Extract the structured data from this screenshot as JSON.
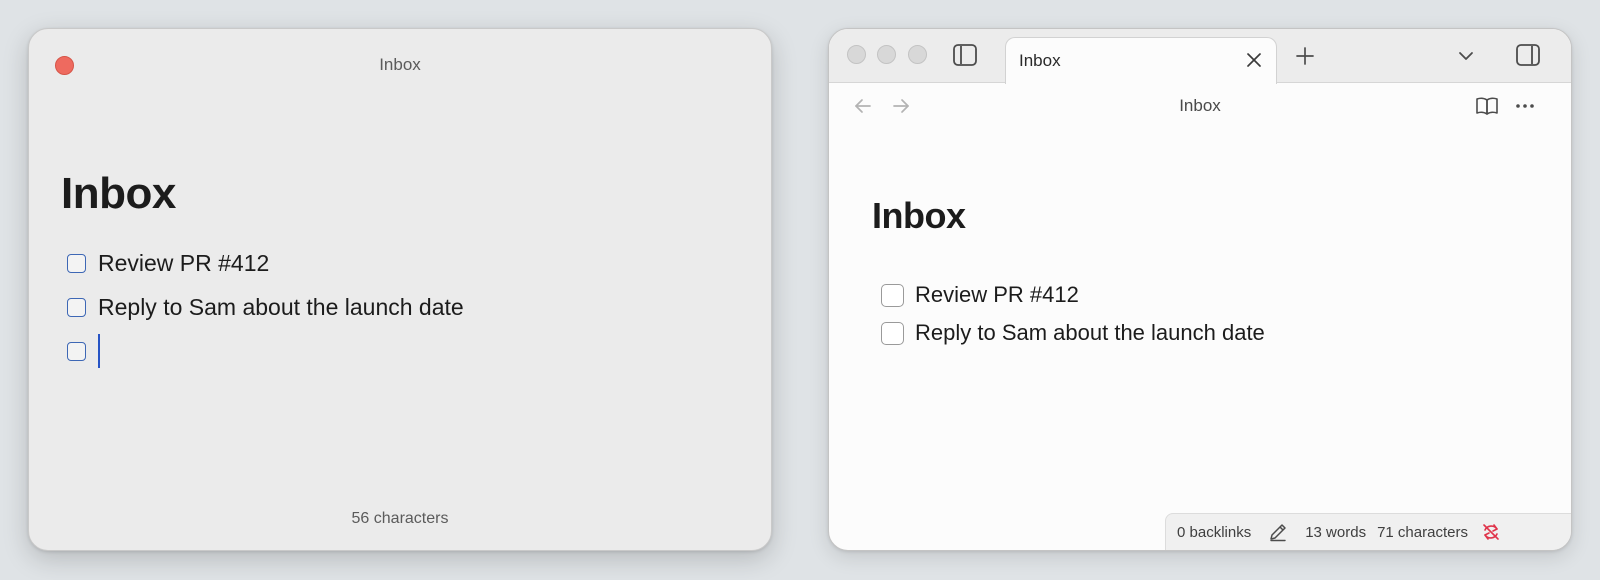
{
  "quick_note": {
    "window_title": "Inbox",
    "heading": "Inbox",
    "tasks": [
      {
        "label": "Review PR #412",
        "checked": false
      },
      {
        "label": "Reply to Sam about the launch date",
        "checked": false
      },
      {
        "label": "",
        "checked": false
      }
    ],
    "status": "56 characters"
  },
  "app": {
    "tab": {
      "label": "Inbox",
      "close_icon": "close-icon"
    },
    "toolbar_icons": [
      "sidebar-toggle-icon",
      "new-tab-icon",
      "tab-list-chevron-icon",
      "right-sidebar-icon"
    ],
    "nav": {
      "title": "Inbox",
      "back_icon": "arrow-left-icon",
      "forward_icon": "arrow-right-icon",
      "reading_icon": "book-open-icon",
      "more_icon": "more-options-icon"
    },
    "note": {
      "heading": "Inbox",
      "tasks": [
        {
          "label": "Review PR #412",
          "checked": false
        },
        {
          "label": "Reply to Sam about the launch date",
          "checked": false
        }
      ]
    },
    "status_bar": {
      "backlinks": "0 backlinks",
      "words": "13 words",
      "characters": "71 characters",
      "edit_icon": "pencil-icon",
      "sync_icon": "sync-error-icon",
      "sync_color": "#e0334a"
    }
  },
  "colors": {
    "caret": "#2754c5",
    "checkbox_quick": "#3d67b5",
    "close_button": "#ee6a5f"
  }
}
